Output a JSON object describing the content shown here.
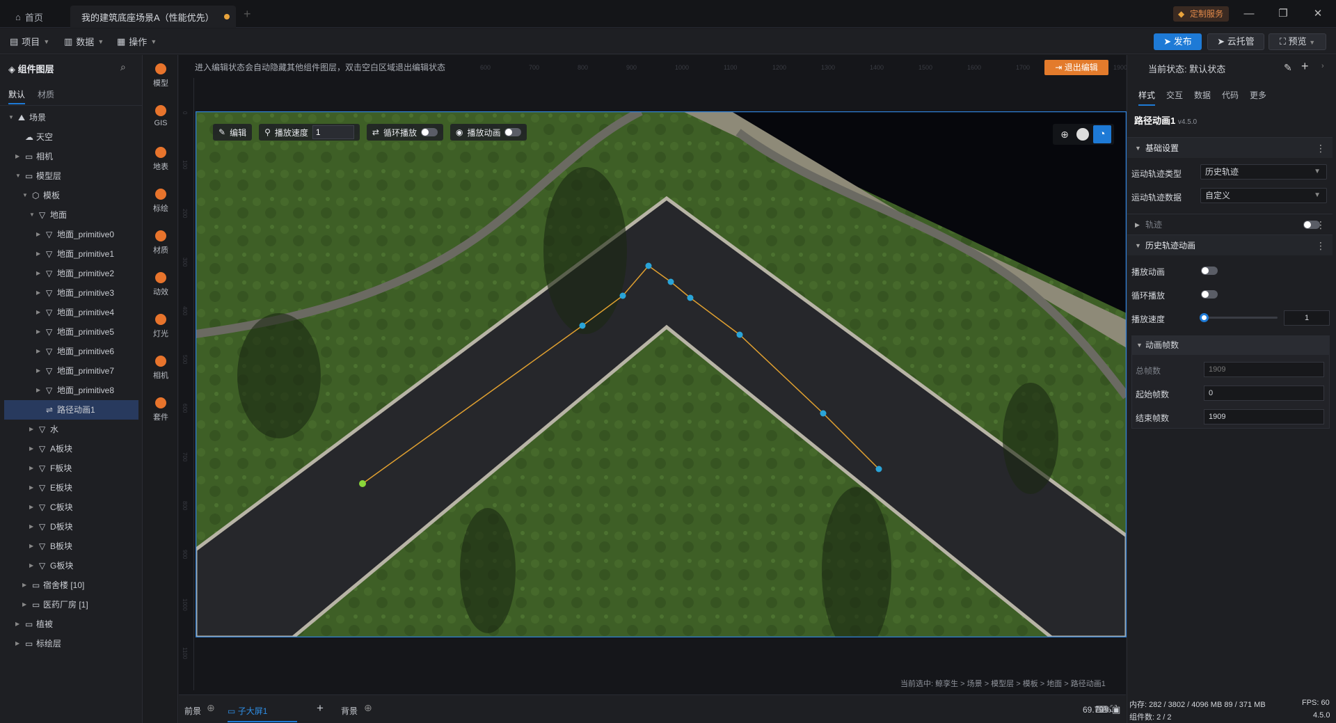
{
  "titlebar": {
    "home_tab": "首页",
    "project_tab": "我的建筑底座场景A（性能优先）",
    "custom_service": "定制服务"
  },
  "menubar": {
    "project": "项目",
    "data": "数据",
    "operate": "操作",
    "publish": "发布",
    "cloud": "云托管",
    "preview": "预览"
  },
  "left_panel": {
    "title": "组件图层",
    "subtabs": [
      "默认",
      "材质"
    ],
    "tree": [
      {
        "label": "场景",
        "depth": 0,
        "icon": "scene-icon",
        "expanded": true
      },
      {
        "label": "天空",
        "depth": 1,
        "icon": "sky-icon",
        "expanded": null
      },
      {
        "label": "相机",
        "depth": 1,
        "icon": "folder-icon",
        "expanded": false
      },
      {
        "label": "模型层",
        "depth": 1,
        "icon": "folder-icon",
        "expanded": true
      },
      {
        "label": "模板",
        "depth": 2,
        "icon": "cube-icon",
        "expanded": true
      },
      {
        "label": "地面",
        "depth": 3,
        "icon": "mesh-icon",
        "expanded": true
      },
      {
        "label": "地面_primitive0",
        "depth": 4,
        "icon": "mesh-icon",
        "expanded": false
      },
      {
        "label": "地面_primitive1",
        "depth": 4,
        "icon": "mesh-icon",
        "expanded": false
      },
      {
        "label": "地面_primitive2",
        "depth": 4,
        "icon": "mesh-icon",
        "expanded": false
      },
      {
        "label": "地面_primitive3",
        "depth": 4,
        "icon": "mesh-icon",
        "expanded": false
      },
      {
        "label": "地面_primitive4",
        "depth": 4,
        "icon": "mesh-icon",
        "expanded": false
      },
      {
        "label": "地面_primitive5",
        "depth": 4,
        "icon": "mesh-icon",
        "expanded": false
      },
      {
        "label": "地面_primitive6",
        "depth": 4,
        "icon": "mesh-icon",
        "expanded": false
      },
      {
        "label": "地面_primitive7",
        "depth": 4,
        "icon": "mesh-icon",
        "expanded": false
      },
      {
        "label": "地面_primitive8",
        "depth": 4,
        "icon": "mesh-icon",
        "expanded": false
      },
      {
        "label": "路径动画1",
        "depth": 4,
        "icon": "path-icon",
        "expanded": null,
        "selected": true
      },
      {
        "label": "水",
        "depth": 3,
        "icon": "mesh-icon",
        "expanded": false
      },
      {
        "label": "A板块",
        "depth": 3,
        "icon": "mesh-icon",
        "expanded": false
      },
      {
        "label": "F板块",
        "depth": 3,
        "icon": "mesh-icon",
        "expanded": false
      },
      {
        "label": "E板块",
        "depth": 3,
        "icon": "mesh-icon",
        "expanded": false
      },
      {
        "label": "C板块",
        "depth": 3,
        "icon": "mesh-icon",
        "expanded": false
      },
      {
        "label": "D板块",
        "depth": 3,
        "icon": "mesh-icon",
        "expanded": false
      },
      {
        "label": "B板块",
        "depth": 3,
        "icon": "mesh-icon",
        "expanded": false
      },
      {
        "label": "G板块",
        "depth": 3,
        "icon": "mesh-icon",
        "expanded": false
      },
      {
        "label": "宿舍楼 [10]",
        "depth": 2,
        "icon": "folder-icon",
        "expanded": false
      },
      {
        "label": "医药厂房 [1]",
        "depth": 2,
        "icon": "folder-icon",
        "expanded": false
      },
      {
        "label": "植被",
        "depth": 1,
        "icon": "folder-icon",
        "expanded": false
      },
      {
        "label": "标绘层",
        "depth": 1,
        "icon": "folder-icon",
        "expanded": false
      }
    ]
  },
  "icon_bar": [
    {
      "label": "模型",
      "icon": "model-icon"
    },
    {
      "label": "GIS",
      "icon": "gis-icon"
    },
    {
      "label": "地表",
      "icon": "terrain-icon"
    },
    {
      "label": "标绘",
      "icon": "marker-icon"
    },
    {
      "label": "材质",
      "icon": "material-icon"
    },
    {
      "label": "动效",
      "icon": "effect-icon"
    },
    {
      "label": "灯光",
      "icon": "light-icon"
    },
    {
      "label": "相机",
      "icon": "camera-icon"
    },
    {
      "label": "套件",
      "icon": "kit-icon"
    }
  ],
  "canvas": {
    "edit_note": "进入编辑状态会自动隐藏其他组件图层，双击空白区域退出编辑状态",
    "exit_edit": "退出编辑",
    "ruler_ticks": [
      "600",
      "700",
      "800",
      "900",
      "1000",
      "1100",
      "1200",
      "1300",
      "1400",
      "1500",
      "1600",
      "1700",
      "1800",
      "1900"
    ],
    "vruler_ticks": [
      "0",
      "100",
      "200",
      "300",
      "400",
      "500",
      "600",
      "700",
      "800",
      "900",
      "1000",
      "1100"
    ],
    "toolbar": {
      "edit": "编辑",
      "speed_label": "播放速度",
      "speed_value": "1",
      "loop": "循环播放",
      "play": "播放动画"
    },
    "breadcrumb": "当前选中: 鲸孪生 > 场景 > 模型层 > 模板 > 地面 > 路径动画1"
  },
  "bottom_bar": {
    "foreground": "前景",
    "sub_screen": "子大屏1",
    "background": "背景",
    "zoom": "69.79%"
  },
  "right_panel": {
    "state_label": "当前状态:",
    "state_value": "默认状态",
    "tabs": [
      "样式",
      "交互",
      "数据",
      "代码",
      "更多"
    ],
    "component_name": "路径动画1",
    "component_version": "v4.5.0",
    "basic_settings": "基础设置",
    "motion_type_label": "运动轨迹类型",
    "motion_type_value": "历史轨迹",
    "motion_data_label": "运动轨迹数据",
    "motion_data_value": "自定义",
    "track_label": "轨迹",
    "history_anim": "历史轨迹动画",
    "play_anim_label": "播放动画",
    "loop_label": "循环播放",
    "speed_label": "播放速度",
    "speed_value": "1",
    "frames_section": "动画帧数",
    "total_frames_label": "总帧数",
    "total_frames_value": "1909",
    "start_frame_label": "起始帧数",
    "start_frame_value": "0",
    "end_frame_label": "结束帧数",
    "end_frame_value": "1909"
  },
  "status": {
    "memory": "内存: 282 / 3802 / 4096 MB  89 / 371 MB",
    "fps": "FPS: 60",
    "components": "组件数: 2 / 2",
    "version": "4.5.0"
  },
  "colors": {
    "accent": "#1e7ad6",
    "orange": "#e37b2c",
    "path_line": "#e0a030",
    "path_node": "#2aa4d8",
    "path_start": "#8ad63a"
  }
}
